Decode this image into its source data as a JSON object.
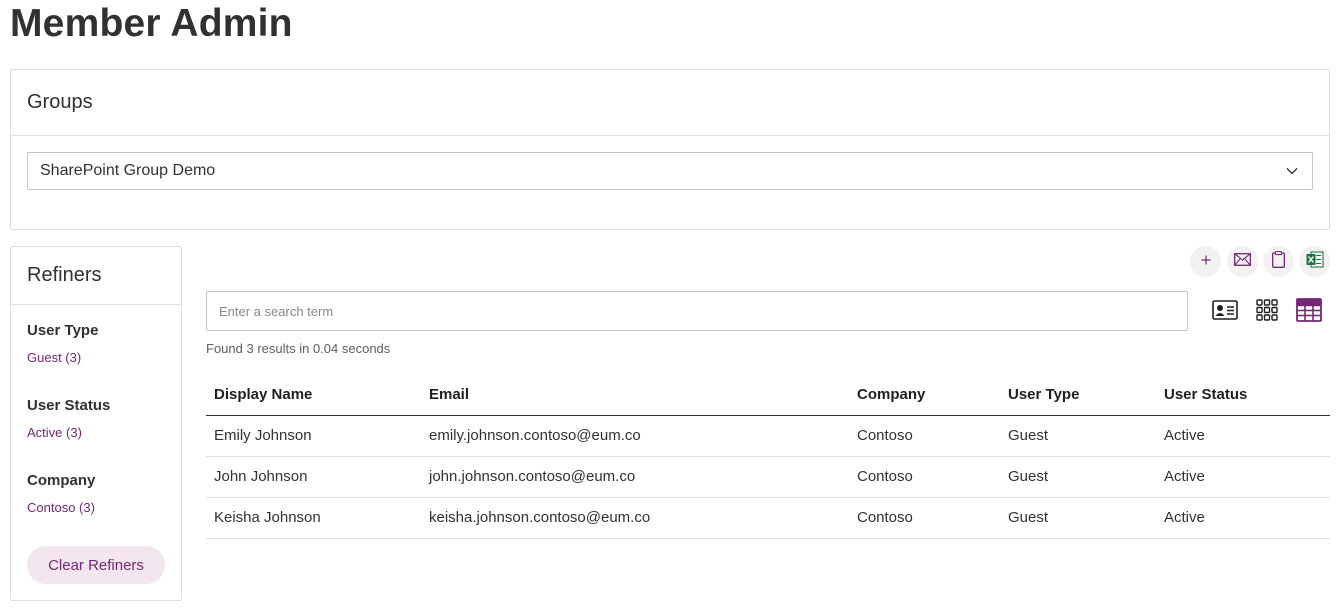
{
  "page": {
    "title": "Member Admin"
  },
  "groups": {
    "title": "Groups",
    "selected": "SharePoint Group Demo"
  },
  "refiners": {
    "title": "Refiners",
    "groups": [
      {
        "heading": "User Type",
        "item": "Guest (3)"
      },
      {
        "heading": "User Status",
        "item": "Active (3)"
      },
      {
        "heading": "Company",
        "item": "Contoso (3)"
      }
    ],
    "clear_label": "Clear Refiners"
  },
  "actions": [
    {
      "icon": "plus-icon"
    },
    {
      "icon": "mail-icon"
    },
    {
      "icon": "clipboard-icon"
    },
    {
      "icon": "excel-icon"
    }
  ],
  "search": {
    "placeholder": "Enter a search term",
    "value": ""
  },
  "views": [
    {
      "icon": "contact-card-icon",
      "selected": false
    },
    {
      "icon": "grid-icon",
      "selected": false
    },
    {
      "icon": "table-icon",
      "selected": true
    }
  ],
  "results_text": "Found 3 results in 0.04 seconds",
  "table": {
    "columns": [
      "Display Name",
      "Email",
      "Company",
      "User Type",
      "User Status"
    ],
    "rows": [
      [
        "Emily Johnson",
        "emily.johnson.contoso@eum.co",
        "Contoso",
        "Guest",
        "Active"
      ],
      [
        "John Johnson",
        "john.johnson.contoso@eum.co",
        "Contoso",
        "Guest",
        "Active"
      ],
      [
        "Keisha Johnson",
        "keisha.johnson.contoso@eum.co",
        "Contoso",
        "Guest",
        "Active"
      ]
    ]
  },
  "colors": {
    "accent": "#742774",
    "excel": "#217346",
    "border": "#e1dfdd"
  }
}
